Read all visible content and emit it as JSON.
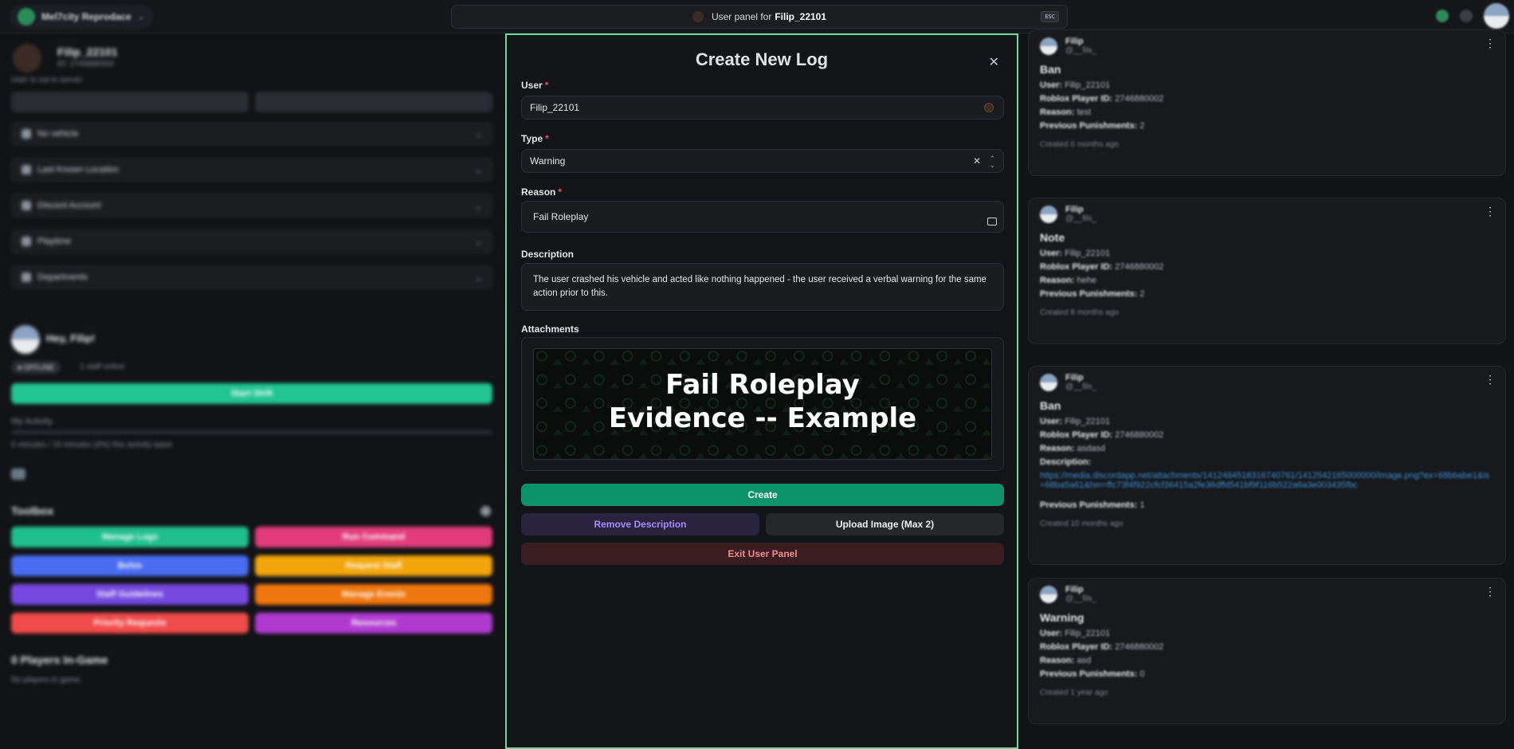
{
  "topbar": {
    "server_name": "Mel7city Reprodace",
    "command_prefix": "User panel for",
    "command_user": "Filip_22101",
    "esc_label": "ESC"
  },
  "left_panel": {
    "profile_name": "Filip_22101",
    "profile_id": "ID: 2746880002",
    "profile_status": "User is not in server.",
    "rows": [
      {
        "label": "No vehicle"
      },
      {
        "label": "Last Known Location"
      },
      {
        "label": "Discord Account"
      },
      {
        "label": "Playtime"
      },
      {
        "label": "Departments"
      }
    ],
    "greeting": "Hey, Filip!",
    "badge": "● OFFLINE",
    "staff_online": "1 staff online",
    "start_shift": "Start Shift",
    "activity_title": "My Activity",
    "activity_text": "0 minutes / 15 minutes (0%) this activity wave",
    "toolbox_title": "Toolbox",
    "toolbox_buttons": [
      {
        "label": "Manage Logs",
        "color": "#1fbf8c"
      },
      {
        "label": "Run Command",
        "color": "#e23d7a"
      },
      {
        "label": "Bolos",
        "color": "#4a6cf0"
      },
      {
        "label": "Request Staff",
        "color": "#f2a50c"
      },
      {
        "label": "Staff Guidelines",
        "color": "#7548e0"
      },
      {
        "label": "Manage Events",
        "color": "#f0760f"
      },
      {
        "label": "Priority Requests",
        "color": "#ef4b4b"
      },
      {
        "label": "Resources",
        "color": "#b03ad0"
      }
    ],
    "players_title": "0 Players In-Game",
    "players_text": "No players in game."
  },
  "modal": {
    "title": "Create New Log",
    "user_label": "User",
    "user_value": "Filip_22101",
    "type_label": "Type",
    "type_value": "Warning",
    "reason_label": "Reason",
    "reason_value": "Fail Roleplay",
    "description_label": "Description",
    "description_value": "The user crashed his vehicle and acted like nothing happened - the user received a verbal warning for the same action prior to this.",
    "attachments_label": "Attachments",
    "attachment_caption_1": "Fail Roleplay",
    "attachment_caption_2": "Evidence -- Example",
    "create_label": "Create",
    "remove_desc_label": "Remove Description",
    "upload_label": "Upload Image (Max 2)",
    "exit_label": "Exit User Panel"
  },
  "logs": [
    {
      "name": "Filip",
      "handle": "@__fils_",
      "type": "Ban",
      "user": "Filip_22101",
      "player_id": "2746880002",
      "reason": "test",
      "description": "",
      "prev": "2",
      "created": "Created 6 months ago"
    },
    {
      "name": "Filip",
      "handle": "@__fils_",
      "type": "Note",
      "user": "Filip_22101",
      "player_id": "2746880002",
      "reason": "hehe",
      "description": "",
      "prev": "2",
      "created": "Created 8 months ago"
    },
    {
      "name": "Filip",
      "handle": "@__fils_",
      "type": "Ban",
      "user": "Filip_22101",
      "player_id": "2746880002",
      "reason": "asdasd",
      "description": "https://media.discordapp.net/attachments/1412484518316740761/1412542165000000/image.png?ex=68bbabe1&is=68ba5a61&hm=ffc73f4f922cfcf36415a2fe36dffd541bf9f116b522a6a3e003435fbc",
      "prev": "1",
      "created": "Created 10 months ago"
    },
    {
      "name": "Filip",
      "handle": "@__fils_",
      "type": "Warning",
      "user": "Filip_22101",
      "player_id": "2746880002",
      "reason": "asd",
      "description": "",
      "prev": "0",
      "created": "Created 1 year ago"
    }
  ],
  "labels": {
    "user_k": "User:",
    "pid_k": "Roblox Player ID:",
    "reason_k": "Reason:",
    "desc_k": "Description:",
    "prev_k": "Previous Punishments:"
  },
  "colors": {
    "modal_border": "#6fdc9e",
    "create": "#0c9368",
    "remove": "#2a2340",
    "exit": "#3a1d20"
  }
}
